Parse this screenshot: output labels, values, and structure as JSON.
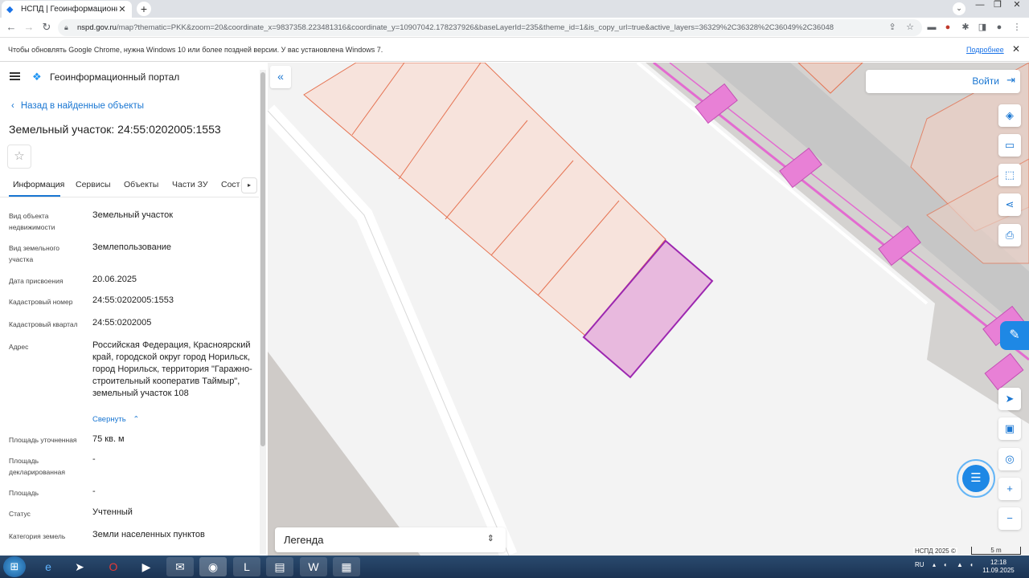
{
  "browser": {
    "tab_title": "НСПД | Геоинформационный п",
    "url_host": "nspd.gov.ru",
    "url_path": "/map?thematic=PKK&zoom=20&coordinate_x=9837358.223481316&coordinate_y=10907042.178237926&baseLayerId=235&theme_id=1&is_copy_url=true&active_layers=36329%2C36328%2C36049%2C36048",
    "info_message": "Чтобы обновлять Google Chrome, нужна Windows 10 или более поздней версии. У вас установлена Windows 7.",
    "info_link": "Подробнее"
  },
  "header": {
    "portal_title": "Геоинформационный портал"
  },
  "panel": {
    "back_label": "Назад в найденные объекты",
    "title": "Земельный участок: 24:55:0202005:1553",
    "tabs": [
      "Информация",
      "Сервисы",
      "Объекты",
      "Части ЗУ",
      "Состав"
    ],
    "collapse_label": "Свернуть",
    "rows": [
      {
        "label": "Вид объекта недвижимости",
        "value": "Земельный участок"
      },
      {
        "label": "Вид земельного участка",
        "value": "Землепользование"
      },
      {
        "label": "Дата присвоения",
        "value": "20.06.2025"
      },
      {
        "label": "Кадастровый номер",
        "value": "24:55:0202005:1553"
      },
      {
        "label": "Кадастровый квартал",
        "value": "24:55:0202005"
      },
      {
        "label": "Адрес",
        "value": "Российская Федерация, Красноярский край, городской округ город Норильск, город Норильск, территория \"Гаражно-строительный кооператив Таймыр\", земельный участок 108"
      },
      {
        "label": "Площадь уточненная",
        "value": "75 кв. м"
      },
      {
        "label": "Площадь декларированная",
        "value": "-"
      },
      {
        "label": "Площадь",
        "value": "-"
      },
      {
        "label": "Статус",
        "value": "Учтенный"
      },
      {
        "label": "Категория земель",
        "value": "Земли населенных пунктов"
      }
    ]
  },
  "map": {
    "login_label": "Войти",
    "legend_label": "Легенда",
    "copyright": "НСПД 2025 ©",
    "scale_label": "5 m",
    "selected_fill": "#e8b9de",
    "selected_stroke": "#9c27b0",
    "parcel_stroke": "#e57352",
    "parcel_fill": "#f7e3dc",
    "road_color": "#cfcfcf",
    "utility_color": "#e36bd0"
  },
  "taskbar": {
    "lang": "RU",
    "time": "12:18",
    "date": "11.09.2025"
  }
}
